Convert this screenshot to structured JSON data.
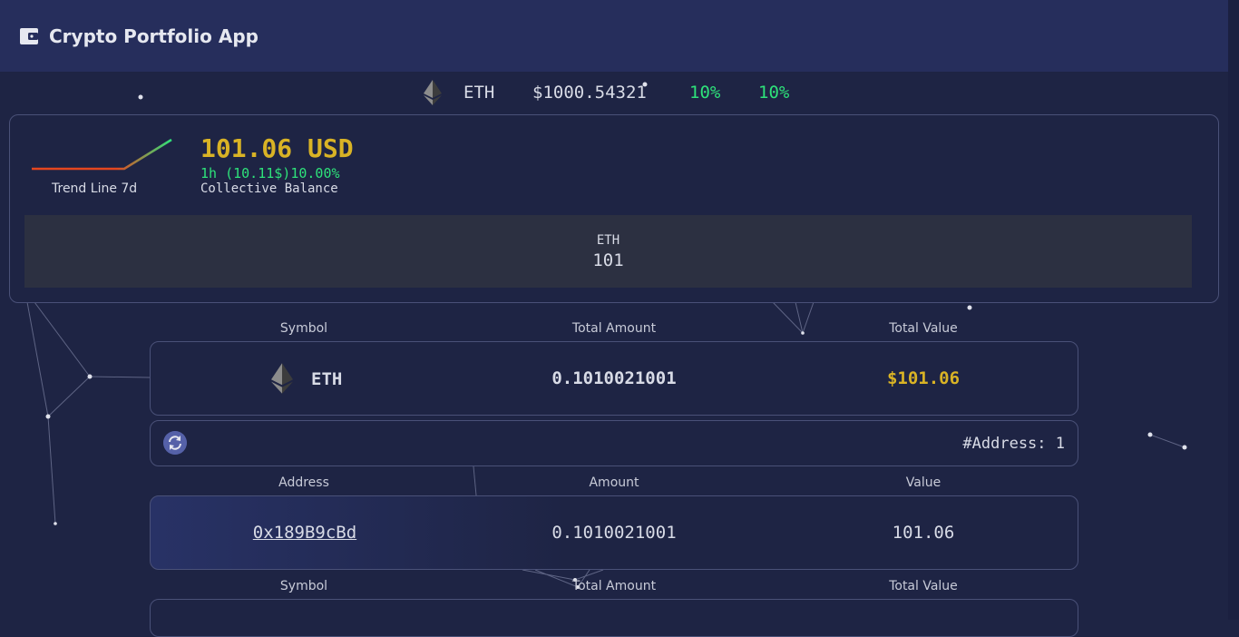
{
  "app": {
    "title": "Crypto Portfolio App"
  },
  "ticker": {
    "symbol": "ETH",
    "price": "$1000.54321",
    "change_a": "10%",
    "change_b": "10%"
  },
  "balance": {
    "amount": "101.06 USD",
    "change": "1h (10.11$)10.00%",
    "label": "Collective Balance",
    "trend_label": "Trend Line 7d",
    "tile": {
      "symbol": "ETH",
      "amount": "101"
    }
  },
  "holdings_table": {
    "headers": [
      "Symbol",
      "Total Amount",
      "Total Value"
    ],
    "row": {
      "symbol": "ETH",
      "total_amount": "0.1010021001",
      "total_value": "$101.06"
    }
  },
  "address_bar": {
    "count_text": "#Address: 1"
  },
  "address_table": {
    "headers": [
      "Address",
      "Amount",
      "Value"
    ],
    "row": {
      "address": "0x189B9cBd",
      "amount": "0.1010021001",
      "value": "101.06"
    }
  },
  "second_table": {
    "headers": [
      "Symbol",
      "Total Amount",
      "Total Value"
    ]
  },
  "colors": {
    "gold": "#d9b325",
    "green": "#2ee27a",
    "background": "#1e2444",
    "header": "#262e5c"
  }
}
